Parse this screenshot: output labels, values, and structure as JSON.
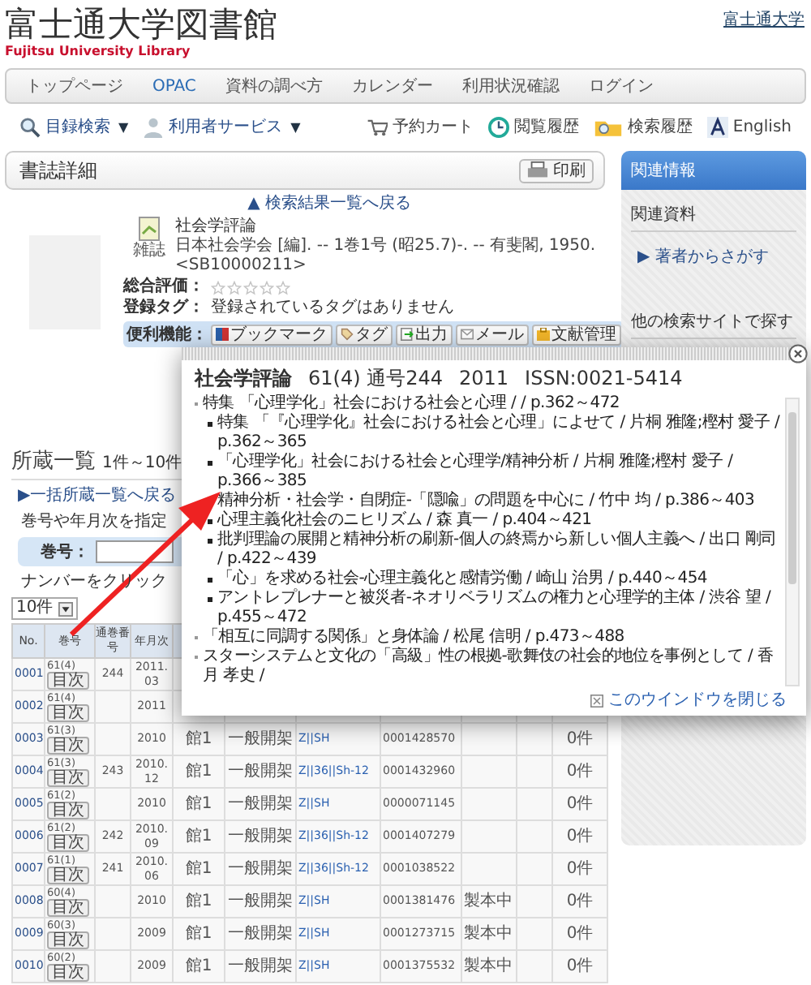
{
  "header": {
    "title": "富士通大学図書館",
    "subtitle": "Fujitsu University Library",
    "top_link": "富士通大学"
  },
  "nav": [
    {
      "label": "トップページ",
      "selected": false
    },
    {
      "label": "OPAC",
      "selected": true
    },
    {
      "label": "資料の調べ方",
      "selected": false
    },
    {
      "label": "カレンダー",
      "selected": false
    },
    {
      "label": "利用状況確認",
      "selected": false
    },
    {
      "label": "ログイン",
      "selected": false
    }
  ],
  "toolbar": {
    "left": [
      {
        "kind": "search",
        "label": "目録検索",
        "caret": "▼"
      },
      {
        "kind": "user",
        "label": "利用者サービス",
        "caret": "▼"
      }
    ],
    "right": [
      {
        "kind": "cart",
        "label": "予約カート"
      },
      {
        "kind": "history",
        "label": "閲覧履歴"
      },
      {
        "kind": "folder",
        "label": "検索履歴"
      },
      {
        "kind": "lang",
        "label": "English"
      }
    ]
  },
  "detail": {
    "heading": "書誌詳細",
    "print_button": "印刷",
    "back_link": "▲ 検索結果一覧へ戻る",
    "type_label": "雑誌",
    "title": "社会学評論",
    "description": "日本社会学会 [編]. -- 1巻1号 (昭25.7)-. -- 有斐閣, 1950. <SB10000211>",
    "rating_label": "総合評価：",
    "stars": 0,
    "tags_label": "登録タグ：",
    "tags_value": "登録されているタグはありません",
    "tools_label": "便利機能：",
    "tools": [
      {
        "kind": "bookmark",
        "label": "ブックマーク"
      },
      {
        "kind": "tag",
        "label": "タグ"
      },
      {
        "kind": "export",
        "label": "出力"
      },
      {
        "kind": "mail",
        "label": "メール"
      },
      {
        "kind": "folder",
        "label": "文献管理"
      }
    ]
  },
  "holdings": {
    "heading": "所蔵一覧",
    "range": "1件～10件",
    "back_link": "▶一括所蔵一覧へ戻る",
    "hint": "巻号や年月次を指定",
    "vol_label": "巻号：",
    "click_hint": "ナンバーをクリック",
    "per_page": "10件",
    "columns": [
      "No.",
      "巻号",
      "通巻番号",
      "年月次"
    ],
    "rows": [
      {
        "no": "0001",
        "vol": "61(4)",
        "toc": "目次",
        "issue": "244",
        "date": "2011. 03"
      },
      {
        "no": "0002",
        "vol": "61(4)",
        "toc": "目次",
        "issue": "",
        "date": "2011"
      },
      {
        "no": "0003",
        "vol": "61(3)",
        "toc": "目次",
        "issue": "",
        "date": "2010",
        "library": "館1",
        "location": "一般開架",
        "call": "Z||SH",
        "id": "0001428570",
        "status": "",
        "count": "0件"
      },
      {
        "no": "0004",
        "vol": "61(3)",
        "toc": "目次",
        "issue": "243",
        "date": "2010. 12",
        "library": "館1",
        "location": "一般開架",
        "call": "Z||36||Sh-12",
        "id": "0001432960",
        "status": "",
        "count": "0件"
      },
      {
        "no": "0005",
        "vol": "61(2)",
        "toc": "目次",
        "issue": "",
        "date": "2010",
        "library": "館1",
        "location": "一般開架",
        "call": "Z||SH",
        "id": "0000071145",
        "status": "",
        "count": "0件"
      },
      {
        "no": "0006",
        "vol": "61(2)",
        "toc": "目次",
        "issue": "242",
        "date": "2010. 09",
        "library": "館1",
        "location": "一般開架",
        "call": "Z||36||Sh-12",
        "id": "0001407279",
        "status": "",
        "count": "0件"
      },
      {
        "no": "0007",
        "vol": "61(1)",
        "toc": "目次",
        "issue": "241",
        "date": "2010. 06",
        "library": "館1",
        "location": "一般開架",
        "call": "Z||36||Sh-12",
        "id": "0001038522",
        "status": "",
        "count": "0件"
      },
      {
        "no": "0008",
        "vol": "60(4)",
        "toc": "目次",
        "issue": "",
        "date": "2010",
        "library": "館1",
        "location": "一般開架",
        "call": "Z||SH",
        "id": "0001381476",
        "status": "製本中",
        "count": "0件"
      },
      {
        "no": "0009",
        "vol": "60(3)",
        "toc": "目次",
        "issue": "",
        "date": "2009",
        "library": "館1",
        "location": "一般開架",
        "call": "Z||SH",
        "id": "0001273715",
        "status": "製本中",
        "count": "0件"
      },
      {
        "no": "0010",
        "vol": "60(2)",
        "toc": "目次",
        "issue": "",
        "date": "2009",
        "library": "館1",
        "location": "一般開架",
        "call": "Z||SH",
        "id": "0001375532",
        "status": "製本中",
        "count": "0件"
      }
    ]
  },
  "sidebar": {
    "heading": "関連情報",
    "section_1": "関連資料",
    "link": "▶ 著者からさがす",
    "section_2": "他の検索サイトで探す"
  },
  "popup": {
    "title": "社会学評論",
    "title_parts": [
      "61(4) 通号244",
      "2011",
      "ISSN:0021-5414"
    ],
    "items": [
      {
        "text": "特集 「心理学化」社会における社会と心理 /  / p.362～472",
        "children": [
          {
            "text": "特集 「『心理学化』社会における社会と心理」によせて / 片桐 雅隆;樫村 愛子 / p.362～365"
          },
          {
            "text": "「心理学化」社会における社会と心理学/精神分析 / 片桐 雅隆;樫村 愛子 / p.366～385"
          },
          {
            "text": "精神分析・社会学・自閉症-「隠喩」の問題を中心に / 竹中 均 / p.386～403"
          },
          {
            "text": "心理主義化社会のニヒリズム / 森 真一 / p.404～421"
          },
          {
            "text": "批判理論の展開と精神分析の刷新-個人の終焉から新しい個人主義へ / 出口 剛司 / p.422～439"
          },
          {
            "text": "「心」を求める社会-心理主義化と感情労働 / 崎山 治男 / p.440～454"
          },
          {
            "text": "アントレプレナーと被災者-ネオリベラリズムの権力と心理学的主体 / 渋谷 望 / p.455～472"
          }
        ]
      },
      {
        "text": "「相互に同調する関係」と身体論 / 松尾 信明 / p.473～488"
      },
      {
        "text": "スターシステムと文化の「高級」性の根拠-歌舞伎の社会的地位を事例として / 香月 孝史 /"
      }
    ],
    "close_link": "このウインドウを閉じる"
  }
}
